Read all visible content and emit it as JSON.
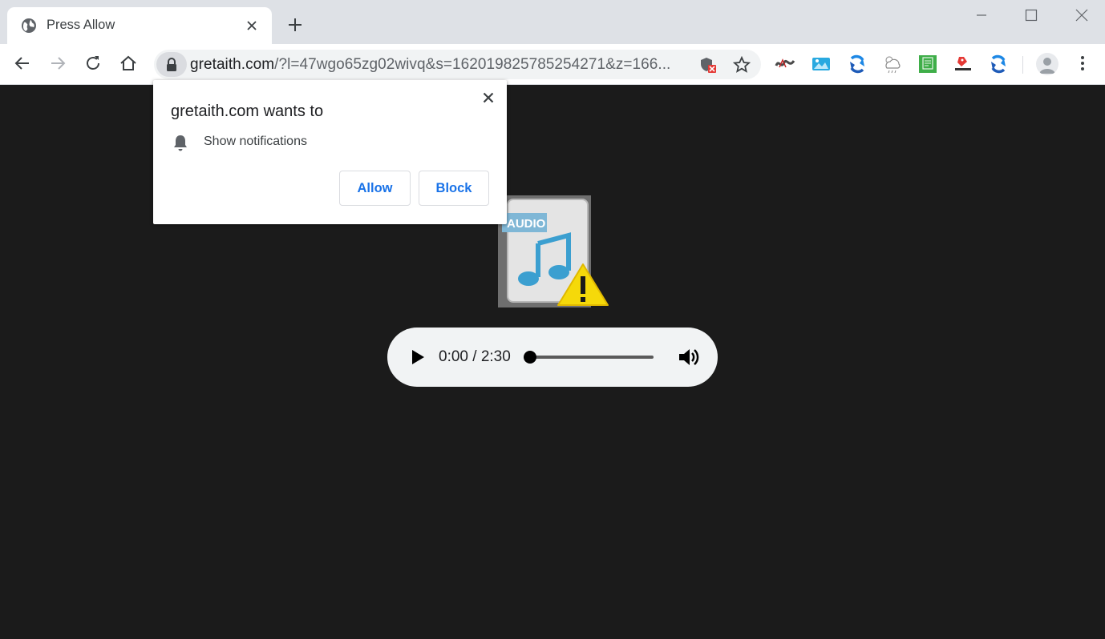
{
  "browser": {
    "tab": {
      "title": "Press Allow"
    },
    "address_bar": {
      "host": "gretaith.com",
      "path": "/?l=47wgo65zg02wivq&s=162019825785254271&z=166..."
    }
  },
  "permission_prompt": {
    "title": "gretaith.com wants to",
    "permission": "Show notifications",
    "allow_label": "Allow",
    "block_label": "Block"
  },
  "page": {
    "audio_icon_label": "AUDIO",
    "player": {
      "time": "0:00 / 2:30",
      "progress": 0.0
    }
  },
  "colors": {
    "accent": "#1a73e8",
    "page_background": "#1b1b1b",
    "warning": "#f5d90a"
  },
  "icons": {
    "tab_favicon": "globe-icon",
    "secure": "lock-icon",
    "permission": "bell-icon"
  }
}
